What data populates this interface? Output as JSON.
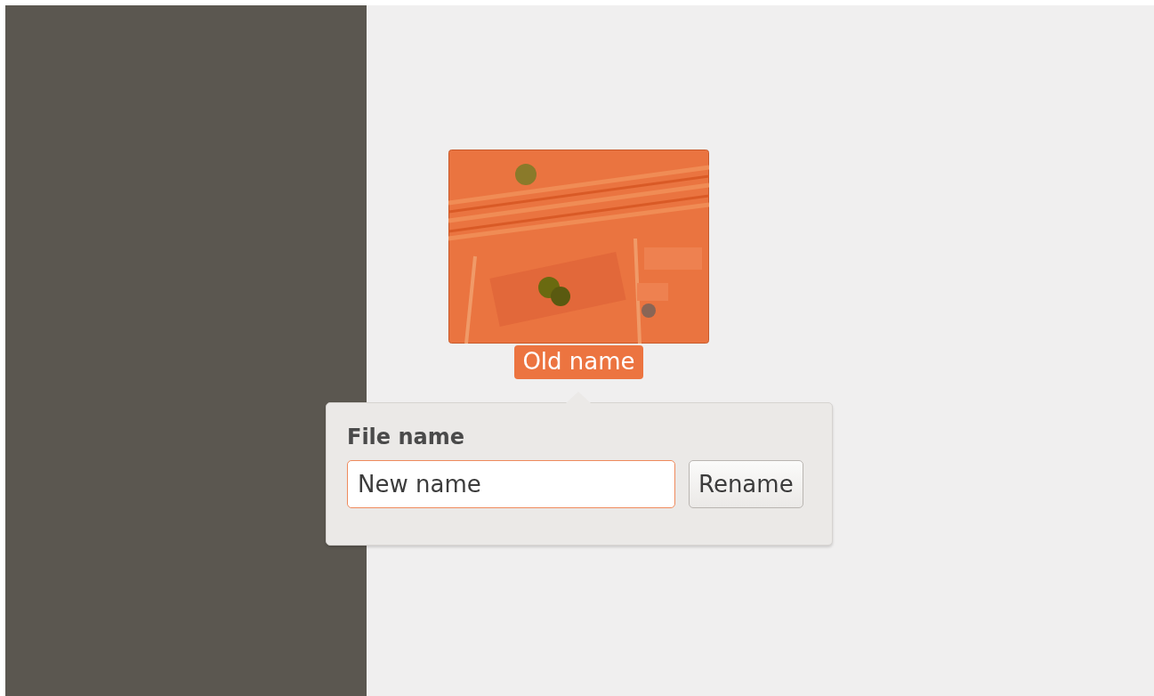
{
  "file": {
    "label": "Old name",
    "selected": true
  },
  "popover": {
    "title": "File name",
    "field": {
      "value": "New name",
      "focused": true
    },
    "button": "Rename"
  }
}
